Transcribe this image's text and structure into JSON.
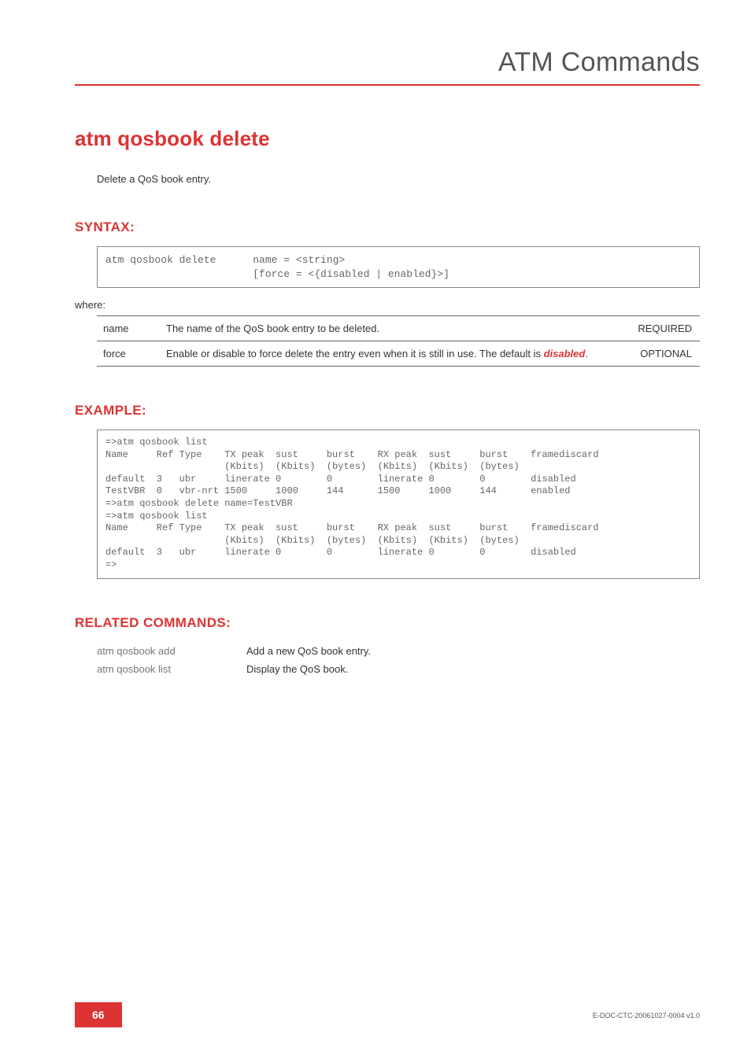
{
  "chapter": "ATM Commands",
  "title": "atm qosbook delete",
  "intro": "Delete a QoS book entry.",
  "syntax": {
    "heading": "SYNTAX:",
    "code": "atm qosbook delete      name = <string>\n                        [force = <{disabled | enabled}>]",
    "where": "where:",
    "params": [
      {
        "name": "name",
        "desc_plain": "The name of the QoS book entry to be deleted.",
        "req": "REQUIRED"
      },
      {
        "name": "force",
        "desc_pre": "Enable or disable to force delete the entry even when it is still in use. The default is ",
        "desc_em": "disabled",
        "desc_post": ".",
        "req": "OPTIONAL"
      }
    ]
  },
  "example": {
    "heading": "EXAMPLE:",
    "code": "=>atm qosbook list\nName     Ref Type    TX peak  sust     burst    RX peak  sust     burst    framediscard\n                     (Kbits)  (Kbits)  (bytes)  (Kbits)  (Kbits)  (bytes)\ndefault  3   ubr     linerate 0        0        linerate 0        0        disabled\nTestVBR  0   vbr-nrt 1500     1000     144      1500     1000     144      enabled\n=>atm qosbook delete name=TestVBR\n=>atm qosbook list\nName     Ref Type    TX peak  sust     burst    RX peak  sust     burst    framediscard\n                     (Kbits)  (Kbits)  (bytes)  (Kbits)  (Kbits)  (bytes)\ndefault  3   ubr     linerate 0        0        linerate 0        0        disabled\n=>"
  },
  "related": {
    "heading": "RELATED COMMANDS:",
    "rows": [
      {
        "cmd": "atm qosbook add",
        "desc": "Add a new QoS book entry."
      },
      {
        "cmd": "atm qosbook list",
        "desc": "Display the QoS book."
      }
    ]
  },
  "footer": {
    "page": "66",
    "docid": "E-DOC-CTC-20061027-0004 v1.0"
  }
}
